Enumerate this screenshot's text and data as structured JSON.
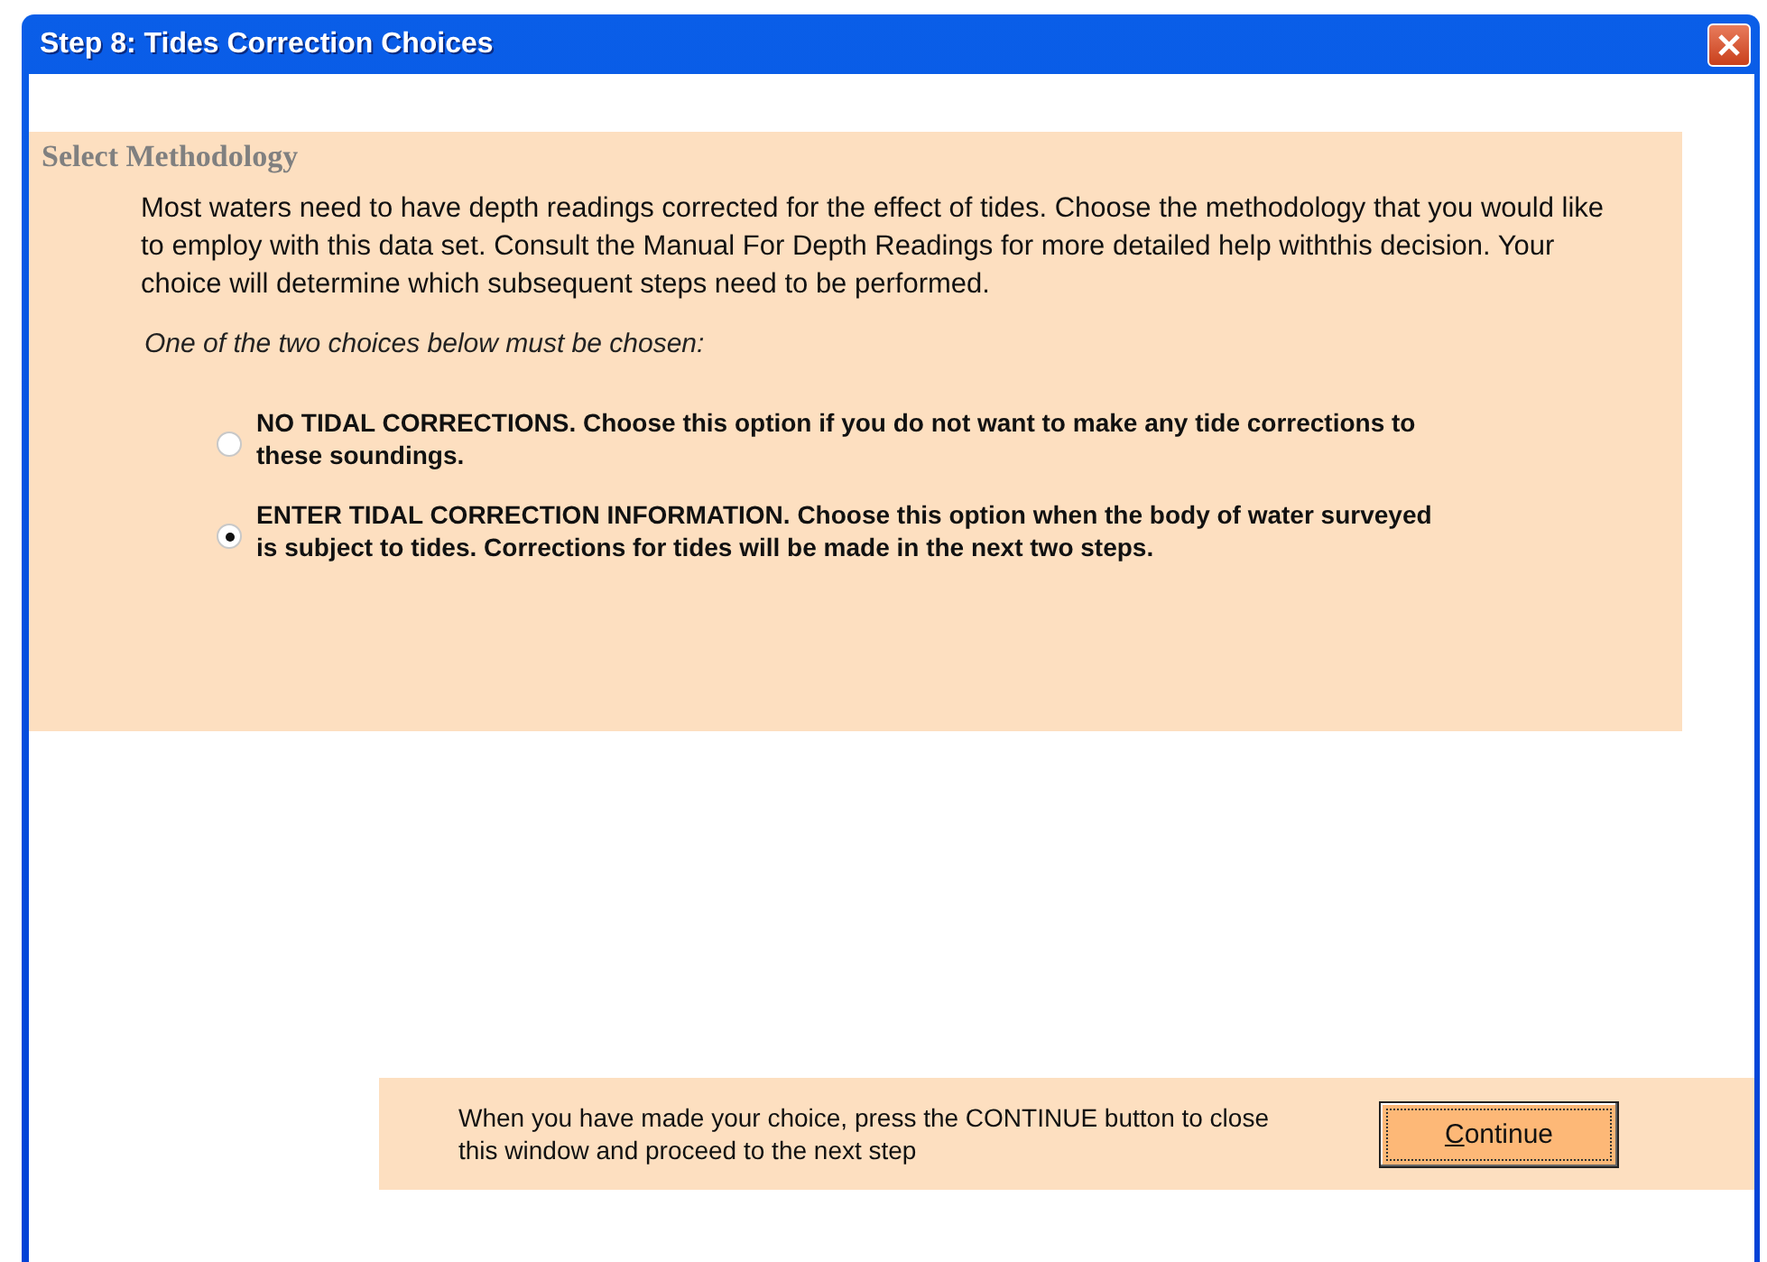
{
  "window": {
    "title": "Step 8: Tides Correction Choices"
  },
  "section": {
    "heading": "Select Methodology",
    "description": "Most waters need to have depth readings corrected for the effect of tides.  Choose the methodology that you would like to employ with this data set.  Consult the Manual For Depth Readings for more detailed help withthis decision.  Your choice will determine which subsequent steps need to be performed.",
    "instruction": "One of the two choices below must be chosen:",
    "options": [
      {
        "label": "NO TIDAL CORRECTIONS.  Choose this option if you do not want to make any tide corrections to these soundings.",
        "selected": false
      },
      {
        "label": "ENTER TIDAL CORRECTION INFORMATION.  Choose this option when the body of water surveyed is subject to tides.  Corrections for tides will be made in the next two steps.",
        "selected": true
      }
    ]
  },
  "footer": {
    "note": "When you have made your choice, press the CONTINUE button to close this window and proceed to the next step",
    "button": "Continue"
  }
}
